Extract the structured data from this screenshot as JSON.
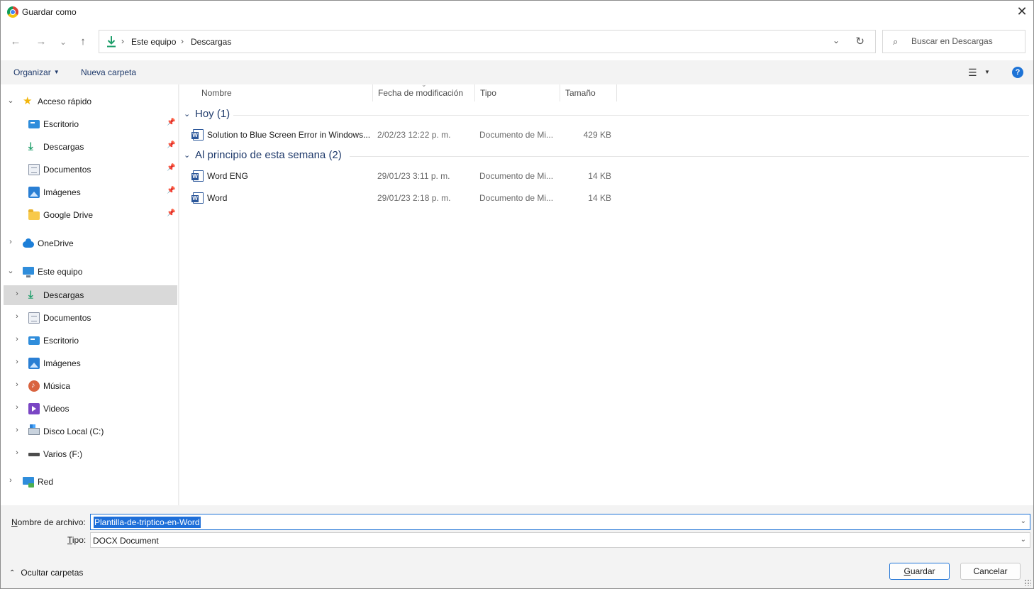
{
  "window": {
    "title": "Guardar como",
    "close_glyph": "✕"
  },
  "nav": {
    "back_glyph": "←",
    "forward_glyph": "→",
    "recent_glyph": "⌄",
    "up_glyph": "↑",
    "breadcrumb": [
      "Este equipo",
      "Descargas"
    ],
    "breadcrumb_sep": "›",
    "dropdown_glyph": "⌄",
    "refresh_glyph": "↻"
  },
  "search": {
    "placeholder": "Buscar en Descargas",
    "icon": "search-icon"
  },
  "toolbar": {
    "organize_label": "Organizar",
    "new_folder_label": "Nueva carpeta",
    "view_glyph": "☰",
    "help_glyph": "?"
  },
  "sidebar": {
    "quick_access": {
      "label": "Acceso rápido",
      "items": [
        {
          "label": "Escritorio",
          "icon": "desktop-icon"
        },
        {
          "label": "Descargas",
          "icon": "download-icon"
        },
        {
          "label": "Documentos",
          "icon": "documents-icon"
        },
        {
          "label": "Imágenes",
          "icon": "images-icon"
        },
        {
          "label": "Google Drive",
          "icon": "folder-icon"
        }
      ]
    },
    "onedrive": {
      "label": "OneDrive"
    },
    "this_pc": {
      "label": "Este equipo",
      "items": [
        {
          "label": "Descargas",
          "icon": "download-icon",
          "selected": true
        },
        {
          "label": "Documentos",
          "icon": "documents-icon"
        },
        {
          "label": "Escritorio",
          "icon": "desktop-icon"
        },
        {
          "label": "Imágenes",
          "icon": "images-icon"
        },
        {
          "label": "Música",
          "icon": "music-icon"
        },
        {
          "label": "Videos",
          "icon": "videos-icon"
        },
        {
          "label": "Disco Local (C:)",
          "icon": "local-disk-icon"
        },
        {
          "label": "Varios (F:)",
          "icon": "drive-icon"
        }
      ]
    },
    "network": {
      "label": "Red"
    }
  },
  "columns": {
    "name": "Nombre",
    "date": "Fecha de modificación",
    "type": "Tipo",
    "size": "Tamaño"
  },
  "groups": [
    {
      "label": "Hoy (1)",
      "files": [
        {
          "name": "Solution to Blue Screen Error in Windows...",
          "date": "2/02/23 12:22 p. m.",
          "type": "Documento de Mi...",
          "size": "429 KB"
        }
      ]
    },
    {
      "label": "Al principio de esta semana (2)",
      "files": [
        {
          "name": "Word ENG",
          "date": "29/01/23 3:11 p. m.",
          "type": "Documento de Mi...",
          "size": "14 KB"
        },
        {
          "name": "Word",
          "date": "29/01/23 2:18 p. m.",
          "type": "Documento de Mi...",
          "size": "14 KB"
        }
      ]
    }
  ],
  "form": {
    "filename_label_u": "N",
    "filename_label_rest": "ombre de archivo:",
    "filename_value": "Plantilla-de-triptico-en-Word",
    "type_label_u": "T",
    "type_label_rest": "ipo:",
    "type_value": "DOCX Document"
  },
  "footer": {
    "hide_folders_label": "Ocultar carpetas",
    "save_label_u": "G",
    "save_label_rest": "uardar",
    "cancel_label": "Cancelar"
  },
  "colors": {
    "accent": "#1e73d6",
    "selection": "#1e6fd9",
    "group_heading": "#1f3a6b"
  }
}
